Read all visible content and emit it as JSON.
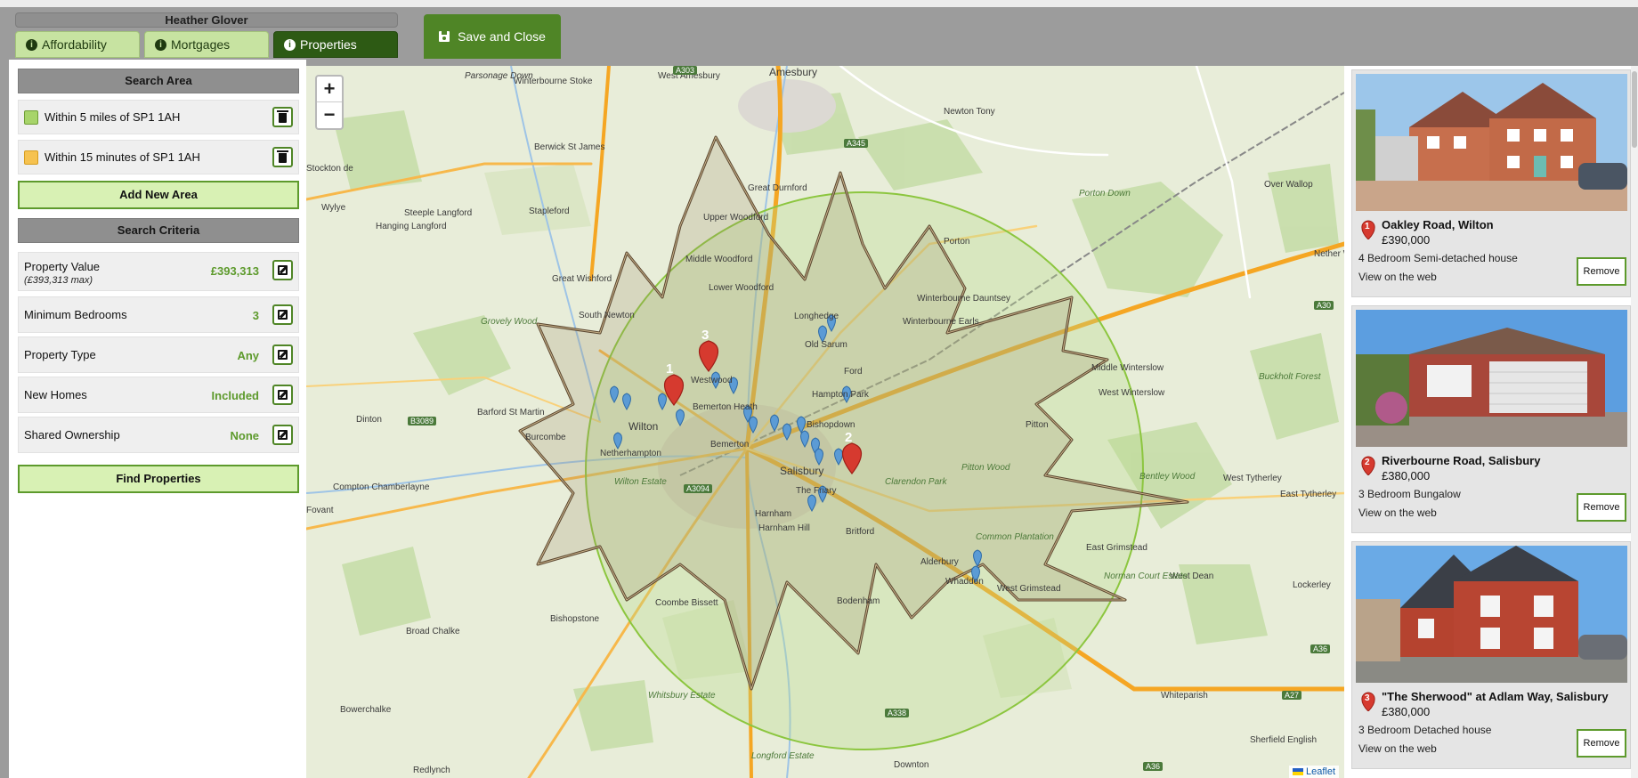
{
  "window": {
    "user_name": "Heather Glover"
  },
  "tabs": [
    {
      "label": "Affordability",
      "icon": "info-icon",
      "active": false
    },
    {
      "label": "Mortgages",
      "icon": "info-icon",
      "active": false
    },
    {
      "label": "Properties",
      "icon": "info-icon",
      "active": true
    }
  ],
  "toolbar": {
    "save_close_label": "Save and Close",
    "save_icon": "floppy-disk-icon"
  },
  "search_area": {
    "header": "Search Area",
    "areas": [
      {
        "label": "Within 5 miles of SP1 1AH",
        "color": "#a7d46a"
      },
      {
        "label": "Within 15 minutes of SP1 1AH",
        "color": "#f6c24f"
      }
    ],
    "add_label": "Add New Area"
  },
  "search_criteria": {
    "header": "Search Criteria",
    "rows": [
      {
        "label": "Property Value",
        "sublabel": "(£393,313 max)",
        "value": "£393,313"
      },
      {
        "label": "Minimum Bedrooms",
        "value": "3"
      },
      {
        "label": "Property Type",
        "value": "Any"
      },
      {
        "label": "New Homes",
        "value": "Included"
      },
      {
        "label": "Shared Ownership",
        "value": "None"
      }
    ],
    "find_label": "Find Properties"
  },
  "map": {
    "zoom_in": "+",
    "zoom_out": "−",
    "attribution": "Leaflet",
    "place_labels": [
      "Amesbury",
      "West Amesbury",
      "Winterbourne Stoke",
      "Parsonage Down",
      "Berwick St James",
      "Newton Tony",
      "Over Wallop",
      "Great Durnford",
      "Upper Woodford",
      "Middle Woodford",
      "Lower Woodford",
      "Stapleford",
      "Steeple Langford",
      "Hanging Langford",
      "Great Wishford",
      "South Newton",
      "Grovely Wood",
      "Wylye",
      "Stockton de",
      "Porton Down",
      "Porton",
      "Winterbourne Dauntsey",
      "Winterbourne Earls",
      "Longhedge",
      "Old Sarum",
      "Ford",
      "Hampton Park",
      "Bishopdown",
      "Westwood",
      "Bemerton Heath",
      "Bemerton",
      "Wilton",
      "Burcombe",
      "Barford St Martin",
      "Dinton",
      "Netherhampton",
      "Wilton Estate",
      "Salisbury",
      "The Friary",
      "Harnham",
      "Harnham Hill",
      "Britford",
      "Clarendon Park",
      "Pitton Wood",
      "Pitton",
      "Middle Winterslow",
      "West Winterslow",
      "Bentley Wood",
      "West Tytherley",
      "East Tytherley",
      "East Grimstead",
      "West Grimstead",
      "West Dean",
      "Norman Court Estate",
      "Lockerley",
      "Alderbury",
      "Whaddon",
      "Common Plantation",
      "Bodenham",
      "Coombe Bissett",
      "Bishopstone",
      "Broad Chalke",
      "Compton Chamberlayne",
      "Fovant",
      "Bowerchalke",
      "Whitsbury Estate",
      "Longford Estate",
      "Downton",
      "Redlynch",
      "Whiteparish",
      "Sherfield English",
      "Nether Wallop",
      "Buckholt Forest"
    ],
    "road_labels": [
      "A303",
      "A345",
      "A30",
      "B3089",
      "A3094",
      "A338",
      "A27",
      "A36",
      "A36"
    ],
    "numbered_pins": [
      "1",
      "2",
      "3"
    ],
    "area_colors": {
      "radius": "#8cc63f",
      "drive_time": "#5a4630"
    }
  },
  "properties": [
    {
      "pin": "1",
      "title": "Oakley Road, Wilton",
      "price": "£390,000",
      "description": "4 Bedroom Semi-detached house",
      "link": "View on the web",
      "remove": "Remove"
    },
    {
      "pin": "2",
      "title": "Riverbourne Road, Salisbury",
      "price": "£380,000",
      "description": "3 Bedroom Bungalow",
      "link": "View on the web",
      "remove": "Remove"
    },
    {
      "pin": "3",
      "title": "\"The Sherwood\" at Adlam Way, Salisbury",
      "price": "£380,000",
      "description": "3 Bedroom Detached house",
      "link": "View on the web",
      "remove": "Remove"
    }
  ]
}
